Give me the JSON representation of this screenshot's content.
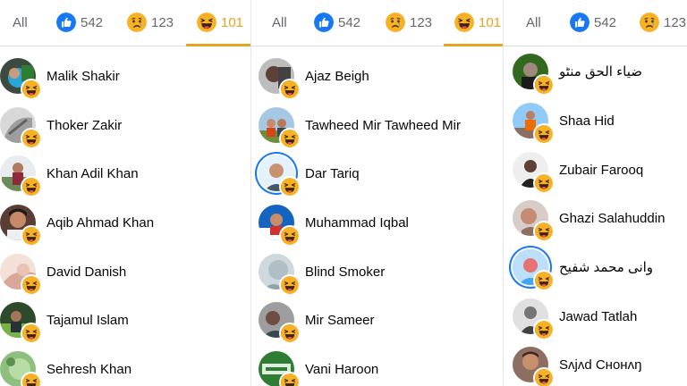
{
  "panels": [
    {
      "tabs": {
        "all": "All",
        "like": "542",
        "sad": "123",
        "haha": "101"
      },
      "people": [
        {
          "name": "Malik Shakir"
        },
        {
          "name": "Thoker Zakir"
        },
        {
          "name": "Khan Adil Khan"
        },
        {
          "name": "Aqib Ahmad Khan"
        },
        {
          "name": "David Danish"
        },
        {
          "name": "Tajamul Islam"
        },
        {
          "name": "Sehresh Khan"
        }
      ]
    },
    {
      "tabs": {
        "all": "All",
        "like": "542",
        "sad": "123",
        "haha": "101"
      },
      "people": [
        {
          "name": "Ajaz Beigh"
        },
        {
          "name": "Tawheed Mir Tawheed Mir"
        },
        {
          "name": "Dar Tariq"
        },
        {
          "name": "Muhammad Iqbal"
        },
        {
          "name": "Blind Smoker"
        },
        {
          "name": "Mir Sameer"
        },
        {
          "name": "Vani Haroon"
        }
      ]
    },
    {
      "tabs": {
        "all": "All",
        "like": "542",
        "sad": "123"
      },
      "people": [
        {
          "name": "ضیاء الحق منٹو"
        },
        {
          "name": "Shaa Hid"
        },
        {
          "name": "Zubair Farooq"
        },
        {
          "name": "Ghazi Salahuddin"
        },
        {
          "name": "وانی محمد شفیح"
        },
        {
          "name": "Jawad Tatlah"
        },
        {
          "name": "Sʌjʌd Cнoнʌŋ"
        }
      ]
    }
  ],
  "colors": {
    "active_tab": "#e4a424",
    "like_blue": "#1877f2",
    "muted_text": "#65676b",
    "divider": "#dadde1"
  },
  "icons": {
    "like": "like-reaction-icon",
    "sad": "sad-reaction-icon",
    "haha": "haha-reaction-icon"
  }
}
